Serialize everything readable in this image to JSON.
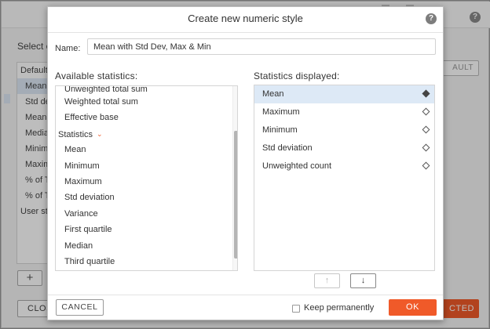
{
  "background": {
    "select_label": "Select e",
    "list_items": [
      "Default",
      "Mean",
      "Std dev",
      "Mean",
      "Media",
      "Minim",
      "Maxim",
      "% of T",
      "% of T",
      "User sty"
    ],
    "add_label": "+",
    "close_label": "CLOS",
    "default_label": "AULT",
    "selected_label": "CTED",
    "help_label": "?"
  },
  "dialog": {
    "title": "Create new numeric style",
    "help_label": "?",
    "name_label": "Name:",
    "name_value": "Mean with Std Dev, Max & Min",
    "available_label": "Available statistics:",
    "displayed_label": "Statistics displayed:",
    "available_items": [
      "Unweighted total sum",
      "Weighted total sum",
      "Effective base",
      "Statistics",
      "Mean",
      "Minimum",
      "Maximum",
      "Std deviation",
      "Variance",
      "First quartile",
      "Median",
      "Third quartile"
    ],
    "group_caret": "⌄",
    "displayed_items": [
      "Mean",
      "Maximum",
      "Minimum",
      "Std deviation",
      "Unweighted count"
    ],
    "move_up_label": "↑",
    "move_down_label": "↓",
    "cancel_label": "CANCEL",
    "keep_label": "Keep permanently",
    "keep_checked": false,
    "ok_label": "OK"
  },
  "colors": {
    "accent": "#f05a29",
    "selection": "#dde9f6"
  }
}
